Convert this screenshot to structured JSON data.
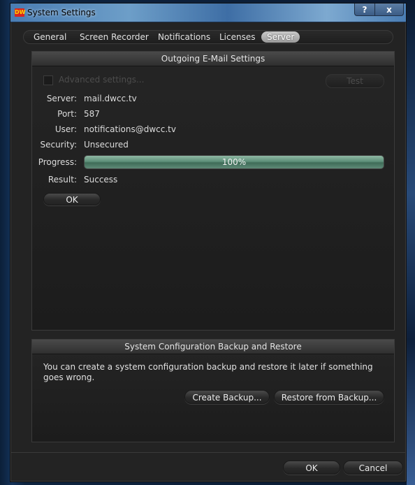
{
  "window": {
    "title": "System Settings",
    "logo_text": "DW",
    "help_label": "?",
    "close_label": "x"
  },
  "tabs": [
    {
      "label": "General",
      "active": false
    },
    {
      "label": "Screen Recorder",
      "active": false
    },
    {
      "label": "Notifications",
      "active": false
    },
    {
      "label": "Licenses",
      "active": false
    },
    {
      "label": "Server",
      "active": true
    }
  ],
  "email": {
    "header": "Outgoing E-Mail Settings",
    "advanced_label": "Advanced settings...",
    "test_label": "Test",
    "fields": [
      {
        "label": "Server:",
        "value": "mail.dwcc.tv"
      },
      {
        "label": "Port:",
        "value": "587"
      },
      {
        "label": "User:",
        "value": "notifications@dwcc.tv"
      },
      {
        "label": "Security:",
        "value": "Unsecured"
      }
    ],
    "progress_label": "Progress:",
    "progress_text": "100%",
    "progress_value": 100,
    "result_label": "Result:",
    "result_value": "Success",
    "ok_label": "OK"
  },
  "backup": {
    "header": "System Configuration Backup and Restore",
    "description": "You can create a system configuration backup and restore it later if something goes wrong.",
    "create_label": "Create Backup...",
    "restore_label": "Restore from Backup..."
  },
  "footer": {
    "ok_label": "OK",
    "cancel_label": "Cancel"
  },
  "colors": {
    "logo_bg": "#d8261e",
    "logo_fg": "#ffd400",
    "progress_fill": "#5d8f79"
  }
}
